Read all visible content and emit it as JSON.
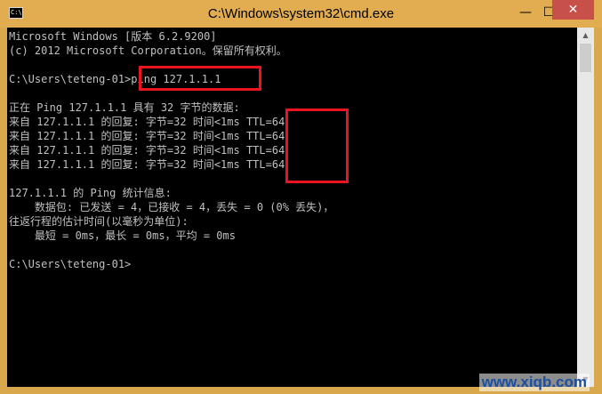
{
  "window": {
    "title": "C:\\Windows\\system32\\cmd.exe",
    "app_icon": "cmd-icon",
    "controls": {
      "minimize_icon": "—",
      "maximize_icon": "☐",
      "close_icon": "✕"
    }
  },
  "console": {
    "lines": [
      "Microsoft Windows [版本 6.2.9200]",
      "(c) 2012 Microsoft Corporation。保留所有权利。",
      "",
      "C:\\Users\\teteng-01>ping 127.1.1.1",
      "",
      "正在 Ping 127.1.1.1 具有 32 字节的数据:",
      "来自 127.1.1.1 的回复: 字节=32 时间<1ms TTL=64",
      "来自 127.1.1.1 的回复: 字节=32 时间<1ms TTL=64",
      "来自 127.1.1.1 的回复: 字节=32 时间<1ms TTL=64",
      "来自 127.1.1.1 的回复: 字节=32 时间<1ms TTL=64",
      "",
      "127.1.1.1 的 Ping 统计信息:",
      "    数据包: 已发送 = 4，已接收 = 4，丢失 = 0 (0% 丢失)，",
      "往返行程的估计时间(以毫秒为单位):",
      "    最短 = 0ms，最长 = 0ms，平均 = 0ms",
      "",
      "C:\\Users\\teteng-01>"
    ],
    "text_color": "#c0c0c0",
    "background": "#000000",
    "highlight_color": "#e8141f"
  },
  "scrollbar": {
    "up_icon": "▲",
    "down_icon": "▼"
  },
  "watermark": "www.xiqb.com"
}
